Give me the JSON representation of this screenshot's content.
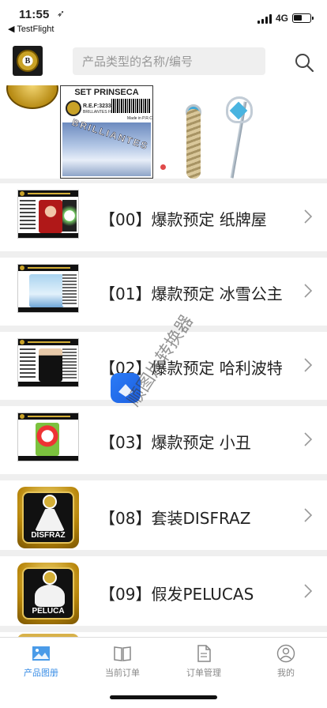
{
  "status_bar": {
    "time": "11:55",
    "location_arrow": "location-arrow-icon",
    "back_app": "◀ TestFlight",
    "network": "4G",
    "battery_level": 0.55
  },
  "header": {
    "search_placeholder": "产品类型的名称/编号"
  },
  "banner": {
    "card_title": "SET PRINSECA",
    "card_ref": "R.E.F:32335",
    "card_brand": "BRILLANTES FIESTA",
    "card_made": "Made in P.R.C",
    "card_text": "BRILLIANTES"
  },
  "list": [
    {
      "title": "【00】爆款预定 纸牌屋"
    },
    {
      "title": "【01】爆款预定 冰雪公主"
    },
    {
      "title": "【02】爆款预定 哈利波特"
    },
    {
      "title": "【03】爆款预定 小丑"
    },
    {
      "title": "【08】套装DISFRAZ",
      "icon_label": "DISFRAZ"
    },
    {
      "title": "【09】假发PELUCAS",
      "icon_label": "PELUCA"
    }
  ],
  "watermark": "顺图片转换器",
  "tabs": [
    {
      "label": "产品图册",
      "active": true
    },
    {
      "label": "当前订单",
      "active": false
    },
    {
      "label": "订单管理",
      "active": false
    },
    {
      "label": "我的",
      "active": false
    }
  ],
  "colors": {
    "accent": "#3a8ee6",
    "gold": "#c9a227",
    "background": "#efefef"
  }
}
